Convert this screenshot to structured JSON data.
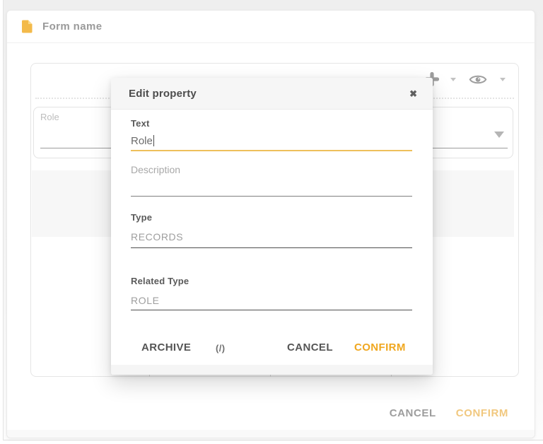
{
  "card": {
    "title": "Form name",
    "actions": {
      "cancel": "CANCEL",
      "confirm": "CONFIRM"
    }
  },
  "canvas": {
    "field": {
      "label": "Role"
    },
    "icons": {
      "add": "plus-icon",
      "add_menu": "caret-down-icon",
      "preview": "eye-icon",
      "preview_menu": "caret-down-icon",
      "field_dropdown": "triangle-down-icon",
      "document": "document-icon"
    }
  },
  "modal": {
    "title": "Edit property",
    "close": "✖",
    "text_field": {
      "label": "Text",
      "value": "Role"
    },
    "description_field": {
      "placeholder": "Description"
    },
    "type_field": {
      "label": "Type",
      "value": "RECORDS"
    },
    "related_type_field": {
      "label": "Related Type",
      "value": "ROLE"
    },
    "buttons": {
      "archive": "ARCHIVE",
      "code": "(/)",
      "cancel": "CANCEL",
      "confirm": "CONFIRM"
    }
  },
  "colors": {
    "accent": "#f0a71f",
    "accent_underline": "#eec05b",
    "confirm_dimmed": "#f1c87f",
    "dark_line": "#4f4f4f",
    "desc_line": "#808080"
  }
}
